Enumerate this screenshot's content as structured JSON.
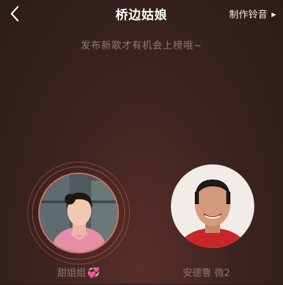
{
  "header": {
    "title": "桥边姑娘",
    "ringtone_label": "制作铃音"
  },
  "subtitle": "发布新歌才有机会上榜哦~",
  "singers": [
    {
      "name": "甜姐姐",
      "emoji": "💞"
    },
    {
      "name": "安德鲁 微2"
    }
  ],
  "colors": {
    "ring": "#e0735f",
    "accent_heart": "#e35ab8"
  },
  "icons": [
    "back-icon",
    "triangle-right-icon",
    "heart-emoji-icon"
  ]
}
